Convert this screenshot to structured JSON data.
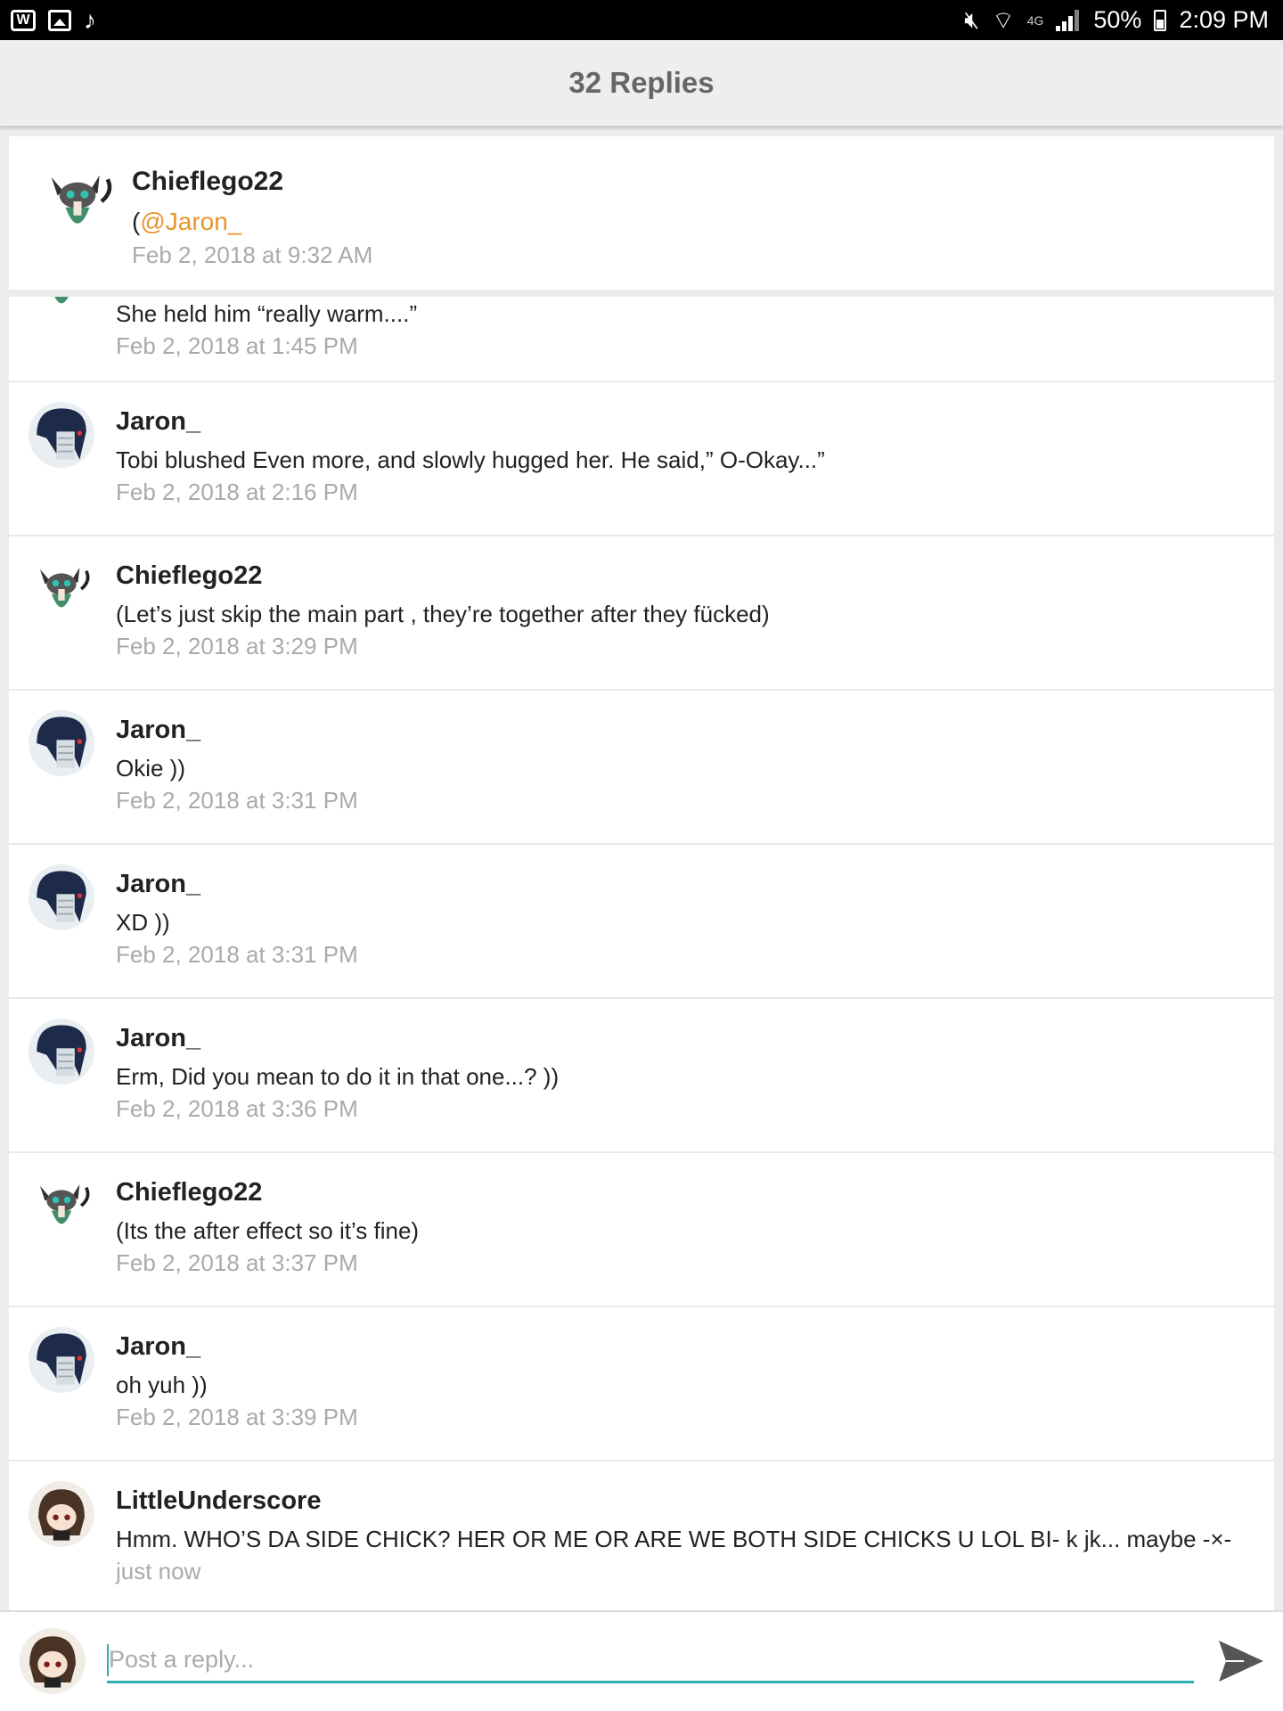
{
  "status_bar": {
    "app_icons": [
      "w-icon",
      "gallery-icon",
      "music-note-icon"
    ],
    "network": "4G",
    "battery": "50%",
    "time": "2:09 PM"
  },
  "header": {
    "title": "32 Replies"
  },
  "original_post": {
    "username": "Chieflego22",
    "body_prefix": "(",
    "mention": "@Jaron_",
    "time": "Feb 2, 2018 at 9:32 AM"
  },
  "replies": [
    {
      "username": "",
      "avatar": "cat-avatar",
      "text": "She held him “really warm....”",
      "time": "Feb 2, 2018 at 1:45 PM"
    },
    {
      "username": "Jaron_",
      "avatar": "blue-hair-avatar",
      "text": "Tobi blushed Even more, and slowly hugged her. He said,” O-Okay...”",
      "time": "Feb 2, 2018 at 2:16 PM"
    },
    {
      "username": "Chieflego22",
      "avatar": "cat-avatar",
      "text": "(Let’s just skip the main part , they’re together after they fücked)",
      "time": "Feb 2, 2018 at 3:29 PM"
    },
    {
      "username": "Jaron_",
      "avatar": "blue-hair-avatar",
      "text": "Okie ))",
      "time": "Feb 2, 2018 at 3:31 PM"
    },
    {
      "username": "Jaron_",
      "avatar": "blue-hair-avatar",
      "text": "XD ))",
      "time": "Feb 2, 2018 at 3:31 PM"
    },
    {
      "username": "Jaron_",
      "avatar": "blue-hair-avatar",
      "text": "Erm, Did you mean to do it in that one...? ))",
      "time": "Feb 2, 2018 at 3:36 PM"
    },
    {
      "username": "Chieflego22",
      "avatar": "cat-avatar",
      "text": "(Its the after effect so it’s fine)",
      "time": "Feb 2, 2018 at 3:37 PM"
    },
    {
      "username": "Jaron_",
      "avatar": "blue-hair-avatar",
      "text": "oh yuh ))",
      "time": "Feb 2, 2018 at 3:39 PM"
    },
    {
      "username": "LittleUnderscore",
      "avatar": "brown-hair-avatar",
      "text": "Hmm. WHO’S DA SIDE CHICK? HER OR ME OR ARE WE BOTH SIDE CHICKS U LOL BI- k jk... maybe -×-",
      "time": "just now"
    }
  ],
  "compose": {
    "placeholder": "Post a reply...",
    "value": "",
    "accent_color": "#2ab0ae"
  },
  "colors": {
    "mention": "#e8952c",
    "timestamp": "#aaaaaa",
    "header_bg": "#eeeeee"
  }
}
